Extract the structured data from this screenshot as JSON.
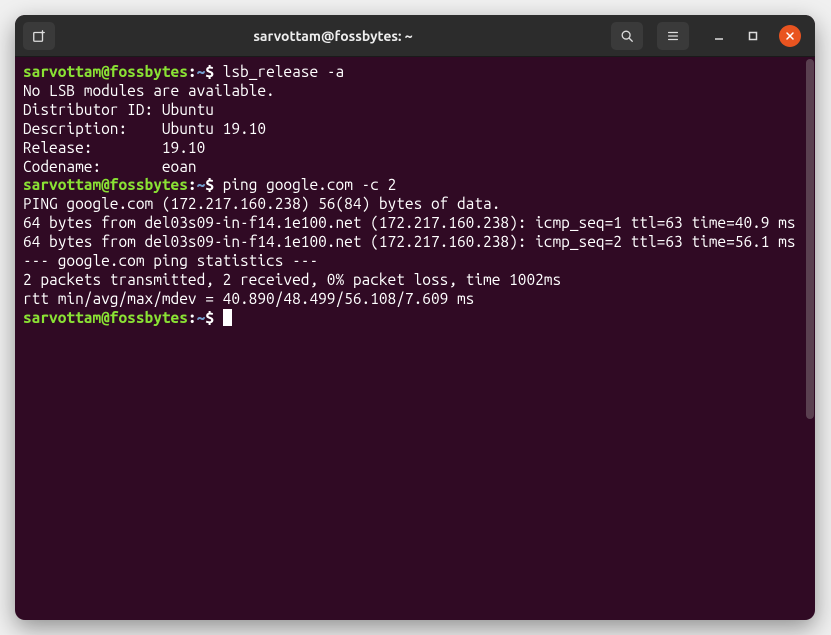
{
  "titlebar": {
    "title": "sarvottam@fossbytes: ~"
  },
  "prompt": {
    "user_host": "sarvottam@fossbytes",
    "colon": ":",
    "path": "~",
    "dollar": "$"
  },
  "lines": [
    {
      "type": "cmd",
      "text": "lsb_release -a"
    },
    {
      "type": "out",
      "text": "No LSB modules are available."
    },
    {
      "type": "out",
      "text": "Distributor ID: Ubuntu"
    },
    {
      "type": "out",
      "text": "Description:    Ubuntu 19.10"
    },
    {
      "type": "out",
      "text": "Release:        19.10"
    },
    {
      "type": "out",
      "text": "Codename:       eoan"
    },
    {
      "type": "cmd",
      "text": "ping google.com -c 2"
    },
    {
      "type": "out",
      "text": "PING google.com (172.217.160.238) 56(84) bytes of data."
    },
    {
      "type": "out",
      "text": "64 bytes from del03s09-in-f14.1e100.net (172.217.160.238): icmp_seq=1 ttl=63 time=40.9 ms"
    },
    {
      "type": "out",
      "text": "64 bytes from del03s09-in-f14.1e100.net (172.217.160.238): icmp_seq=2 ttl=63 time=56.1 ms"
    },
    {
      "type": "out",
      "text": ""
    },
    {
      "type": "out",
      "text": "--- google.com ping statistics ---"
    },
    {
      "type": "out",
      "text": "2 packets transmitted, 2 received, 0% packet loss, time 1002ms"
    },
    {
      "type": "out",
      "text": "rtt min/avg/max/mdev = 40.890/48.499/56.108/7.609 ms"
    },
    {
      "type": "cmd",
      "text": "",
      "cursor": true
    }
  ]
}
